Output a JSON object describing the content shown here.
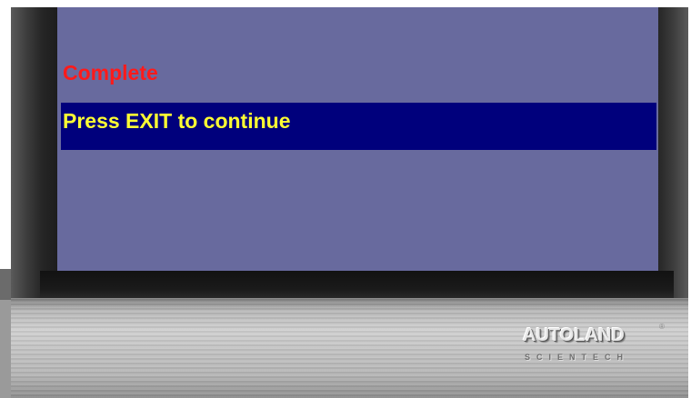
{
  "screen": {
    "status_text": "Complete",
    "message_text": "Press EXIT to continue"
  },
  "brand": {
    "name": "AUTOLAND",
    "tagline": "SCIENTECH",
    "registered_mark": "®"
  },
  "colors": {
    "screen_background": "#686a9e",
    "status_text": "#ff1a1a",
    "message_bar": "#00007c",
    "message_text": "#ffff33"
  }
}
